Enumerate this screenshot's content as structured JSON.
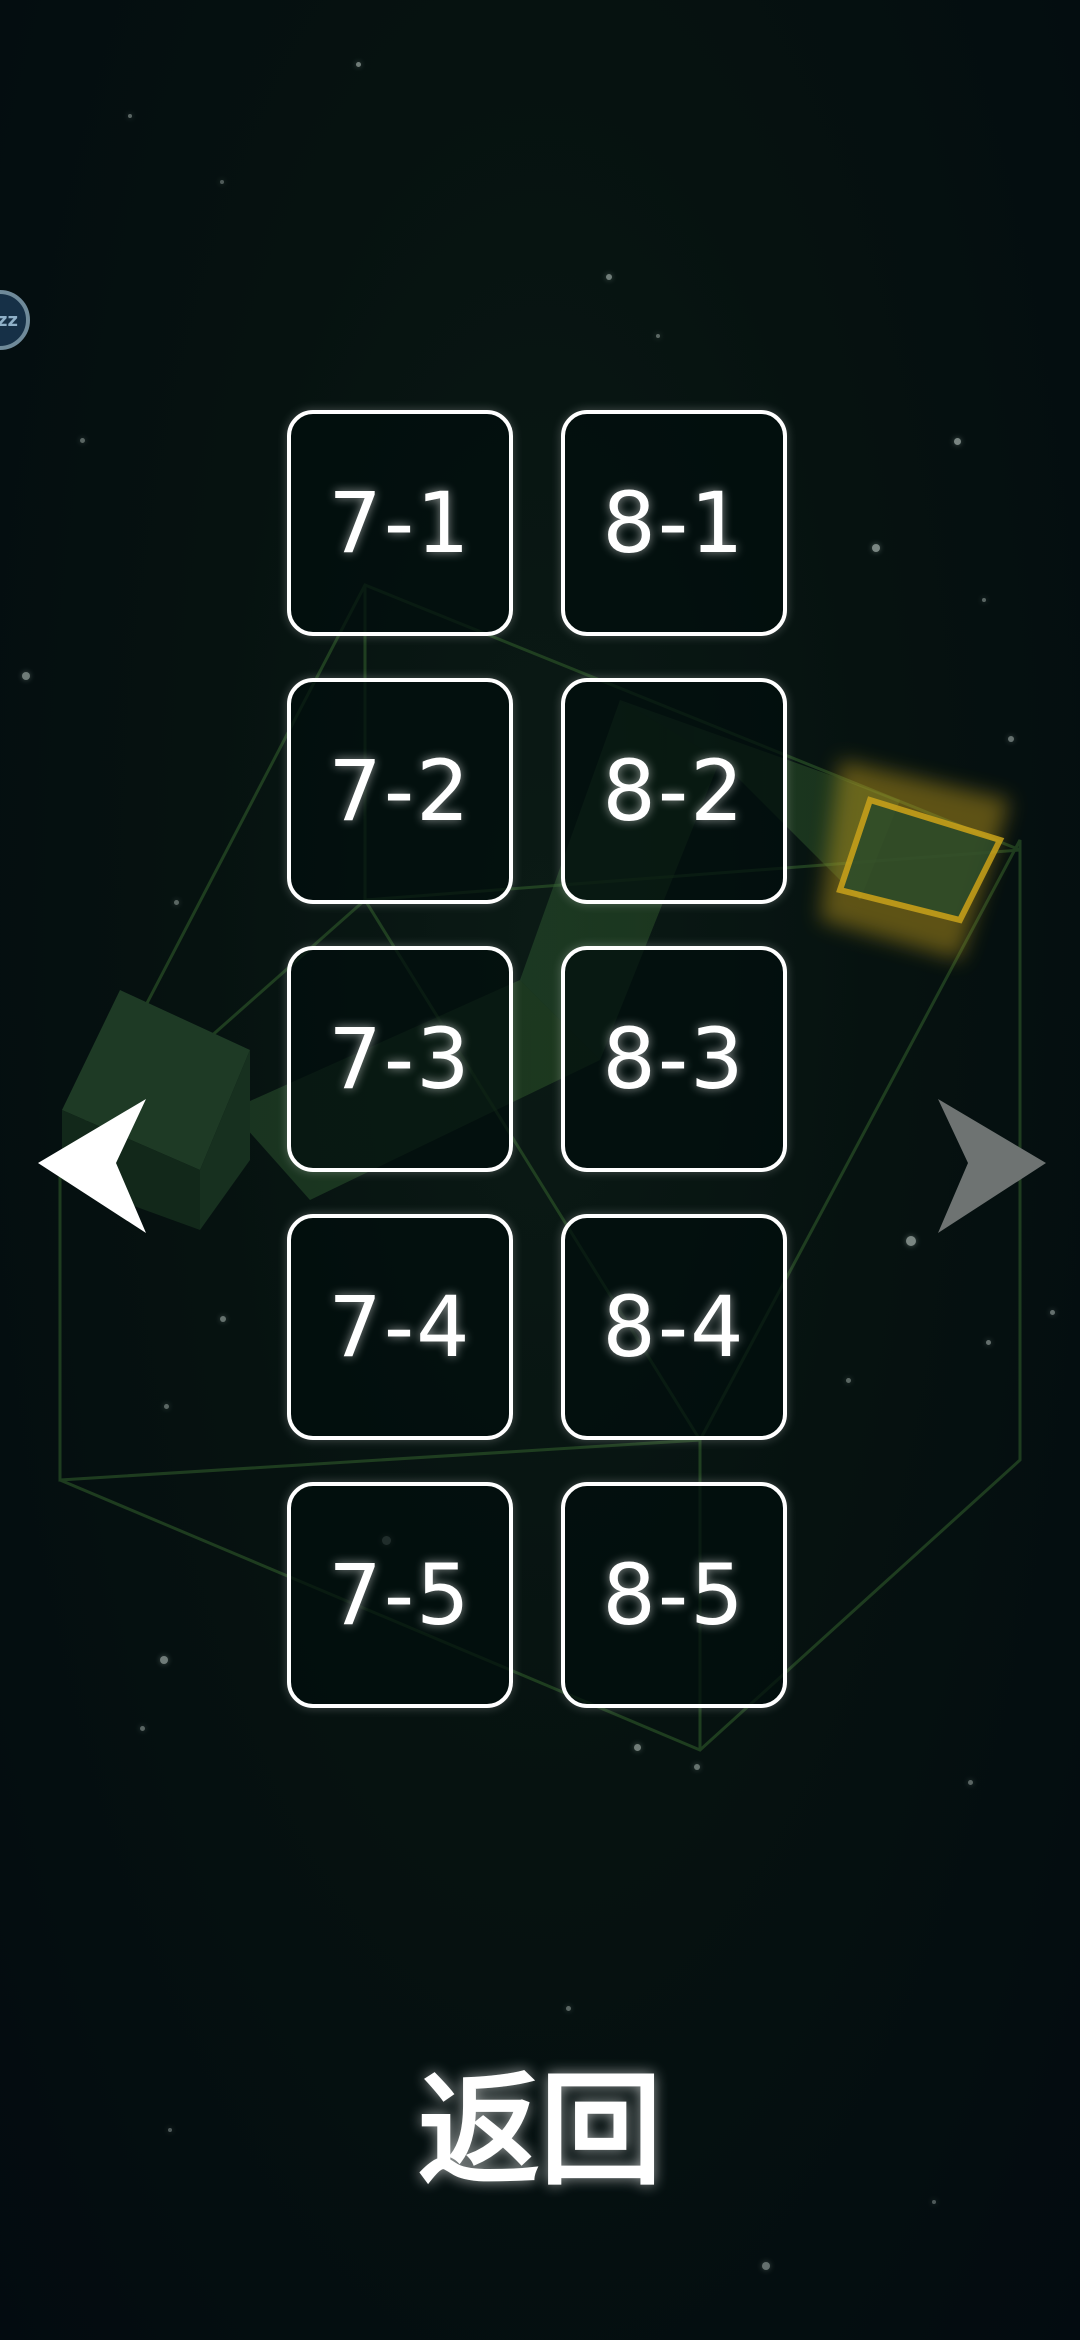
{
  "levels": [
    [
      "7-1",
      "8-1"
    ],
    [
      "7-2",
      "8-2"
    ],
    [
      "7-3",
      "8-3"
    ],
    [
      "7-4",
      "8-4"
    ],
    [
      "7-5",
      "8-5"
    ]
  ],
  "back_label": "返回",
  "sleep_badge_label": "zz",
  "icons": {
    "prev": "left-arrow-icon",
    "next": "right-arrow-icon",
    "sleep": "sleep-icon"
  },
  "colors": {
    "background": "#040d0c",
    "button_border": "#ffffff",
    "button_text": "#ffffff",
    "board_path": "#2e5a32",
    "goal_glow": "#c9a21a",
    "arrow_left": "#ffffff",
    "arrow_right": "#6e7372",
    "sleep_badge": "#163047"
  }
}
